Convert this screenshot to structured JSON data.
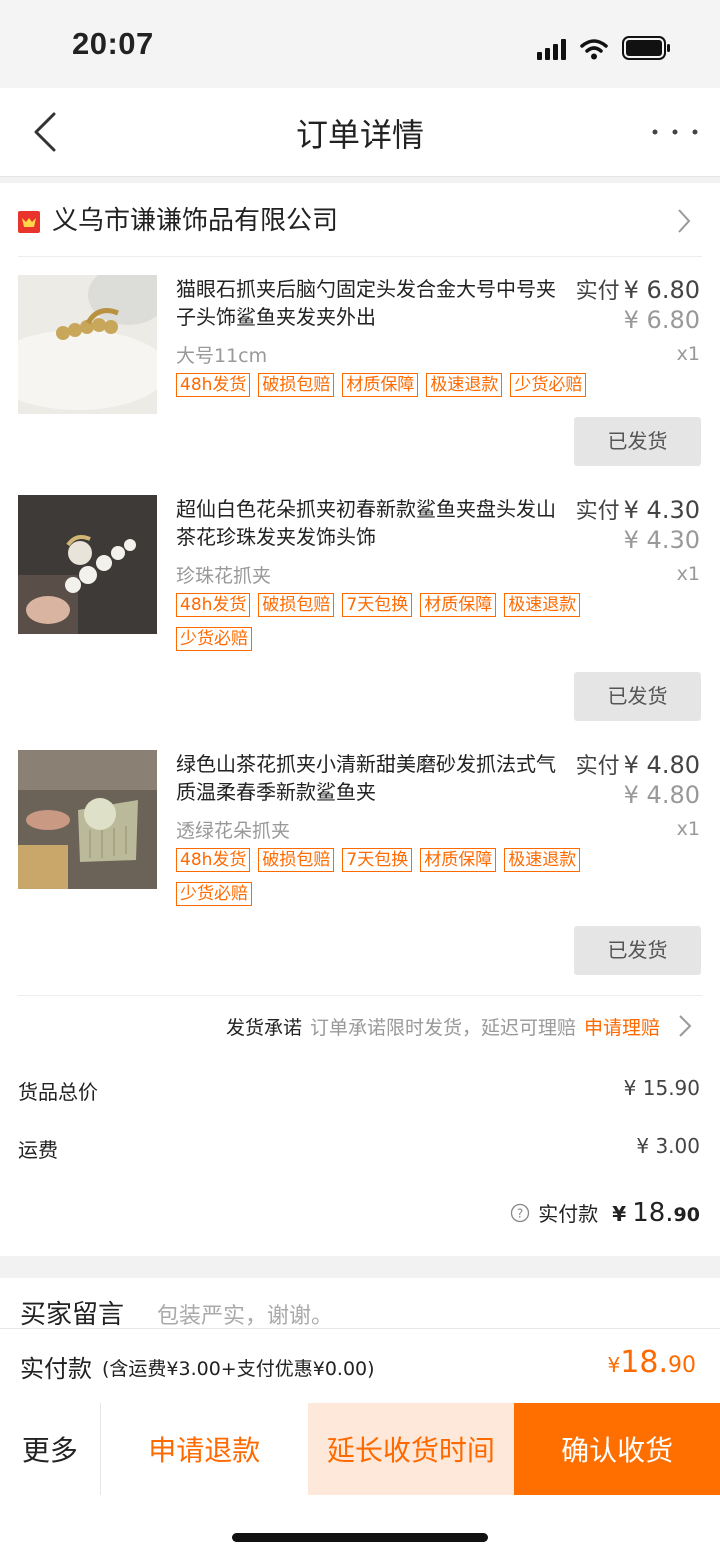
{
  "status_bar": {
    "time": "20:07"
  },
  "nav": {
    "title": "订单详情"
  },
  "shop": {
    "name": "义乌市谦谦饰品有限公司"
  },
  "items": [
    {
      "title": "猫眼石抓夹后脑勺固定头发合金大号中号夹子头饰鲨鱼夹发夹外出",
      "price_label": "实付",
      "price_actual": "¥ 6.80",
      "price_original": "¥ 6.80",
      "spec": "大号11cm",
      "qty": "x1",
      "tags": [
        "48h发货",
        "破损包赔",
        "材质保障",
        "极速退款",
        "少货必赔"
      ],
      "status": "已发货"
    },
    {
      "title": "超仙白色花朵抓夹初春新款鲨鱼夹盘头发山茶花珍珠发夹发饰头饰",
      "price_label": "实付",
      "price_actual": "¥ 4.30",
      "price_original": "¥ 4.30",
      "spec": "珍珠花抓夹",
      "qty": "x1",
      "tags": [
        "48h发货",
        "破损包赔",
        "7天包换",
        "材质保障",
        "极速退款",
        "少货必赔"
      ],
      "status": "已发货"
    },
    {
      "title": "绿色山茶花抓夹小清新甜美磨砂发抓法式气质温柔春季新款鲨鱼夹",
      "price_label": "实付",
      "price_actual": "¥ 4.80",
      "price_original": "¥ 4.80",
      "spec": "透绿花朵抓夹",
      "qty": "x1",
      "tags": [
        "48h发货",
        "破损包赔",
        "7天包换",
        "材质保障",
        "极速退款",
        "少货必赔"
      ],
      "status": "已发货"
    }
  ],
  "promise": {
    "label": "发货承诺",
    "text": "订单承诺限时发货，延迟可理赔",
    "link": "申请理赔"
  },
  "summary": {
    "goods_label": "货品总价",
    "goods_value": "¥ 15.90",
    "shipping_label": "运费",
    "shipping_value": "¥ 3.00",
    "total_label": "实付款",
    "total_yen": "¥",
    "total_int": "18.",
    "total_dec": "90"
  },
  "message": {
    "label": "买家留言",
    "text": "包装严实，谢谢。"
  },
  "paybar": {
    "label": "实付款",
    "detail": "(含运费¥3.00+支付优惠¥0.00)",
    "yen": "¥",
    "int": "18.",
    "dec": "90"
  },
  "actions": {
    "more": "更多",
    "refund": "申请退款",
    "extend": "延长收货时间",
    "confirm": "确认收货"
  },
  "colors": {
    "accent": "#ff6a00",
    "confirm_bg": "#ff6f00",
    "extend_bg": "#fde8da",
    "shipped_bg": "#e5e5e5"
  }
}
